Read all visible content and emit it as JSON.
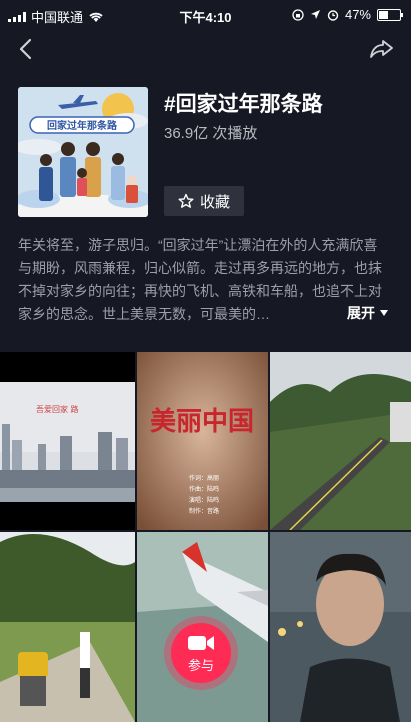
{
  "status_bar": {
    "carrier": "中国联通",
    "time": "下午4:10",
    "battery": "47%",
    "battery_level": 0.47
  },
  "topic": {
    "title": "#回家过年那条路",
    "plays": "36.9亿 次播放",
    "favorite_label": "收藏",
    "cover_text": "回家过年那条路",
    "description": "年关将至，游子思归。“回家过年”让漂泊在外的人充满欣喜与期盼，风雨兼程，归心似箭。走过再多再远的地方，也抹不掉对家乡的向往；再快的飞机、高铁和车船，也追不上对家乡的思念。世上美景无数，可最美的…",
    "expand_label": "展开"
  },
  "videos": [
    {
      "overlay": "吾爱回家 路"
    },
    {
      "overlay": "美丽中国",
      "credits": [
        "作词：高丽",
        "作曲：陆鸣",
        "演唱：陆鸣",
        "制作：音路"
      ]
    },
    {
      "overlay": ""
    },
    {
      "overlay": ""
    },
    {
      "overlay": ""
    },
    {
      "overlay": ""
    }
  ],
  "participate_label": "参与",
  "colors": {
    "background": "#161823",
    "accent": "#fe2c55",
    "button_bg": "#2f313d"
  }
}
